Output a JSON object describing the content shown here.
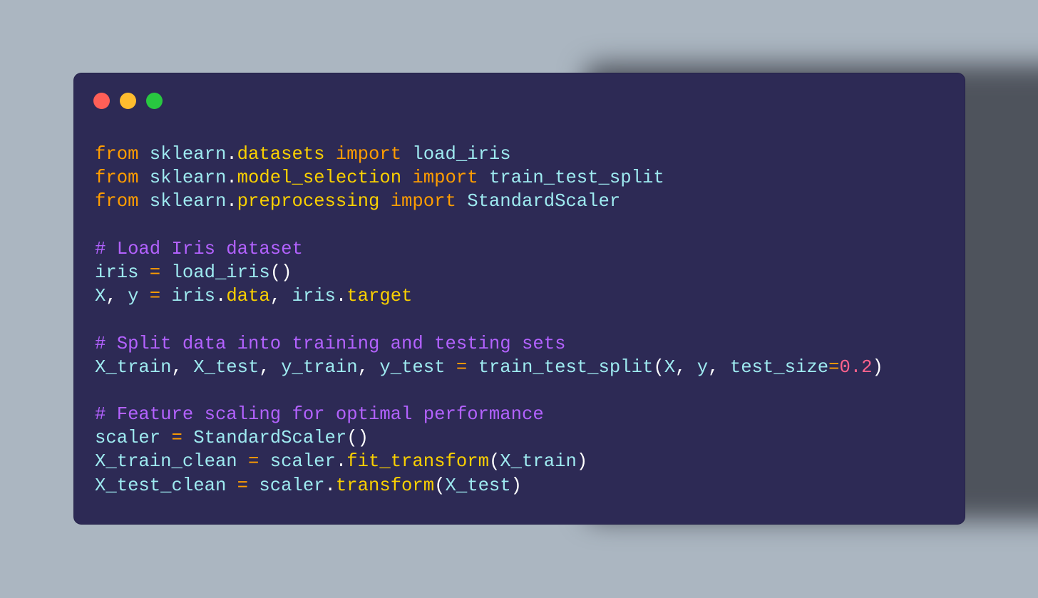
{
  "window": {
    "controls": [
      {
        "name": "close",
        "color": "#ff5f57"
      },
      {
        "name": "minimize",
        "color": "#febc2e"
      },
      {
        "name": "maximize",
        "color": "#28c840"
      }
    ]
  },
  "code": {
    "language": "python",
    "lines": [
      [
        [
          "keyword",
          "from"
        ],
        [
          "text",
          " "
        ],
        [
          "module",
          "sklearn"
        ],
        [
          "punct",
          "."
        ],
        [
          "attr",
          "datasets"
        ],
        [
          "text",
          " "
        ],
        [
          "keyword",
          "import"
        ],
        [
          "text",
          " "
        ],
        [
          "ident",
          "load_iris"
        ]
      ],
      [
        [
          "keyword",
          "from"
        ],
        [
          "text",
          " "
        ],
        [
          "module",
          "sklearn"
        ],
        [
          "punct",
          "."
        ],
        [
          "attr",
          "model_selection"
        ],
        [
          "text",
          " "
        ],
        [
          "keyword",
          "import"
        ],
        [
          "text",
          " "
        ],
        [
          "ident",
          "train_test_split"
        ]
      ],
      [
        [
          "keyword",
          "from"
        ],
        [
          "text",
          " "
        ],
        [
          "module",
          "sklearn"
        ],
        [
          "punct",
          "."
        ],
        [
          "attr",
          "preprocessing"
        ],
        [
          "text",
          " "
        ],
        [
          "keyword",
          "import"
        ],
        [
          "text",
          " "
        ],
        [
          "ident",
          "StandardScaler"
        ]
      ],
      [],
      [
        [
          "comment",
          "# Load Iris dataset"
        ]
      ],
      [
        [
          "ident",
          "iris"
        ],
        [
          "text",
          " "
        ],
        [
          "op",
          "="
        ],
        [
          "text",
          " "
        ],
        [
          "ident",
          "load_iris"
        ],
        [
          "punct",
          "()"
        ]
      ],
      [
        [
          "ident",
          "X"
        ],
        [
          "punct",
          ","
        ],
        [
          "text",
          " "
        ],
        [
          "ident",
          "y"
        ],
        [
          "text",
          " "
        ],
        [
          "op",
          "="
        ],
        [
          "text",
          " "
        ],
        [
          "ident",
          "iris"
        ],
        [
          "punct",
          "."
        ],
        [
          "attr",
          "data"
        ],
        [
          "punct",
          ","
        ],
        [
          "text",
          " "
        ],
        [
          "ident",
          "iris"
        ],
        [
          "punct",
          "."
        ],
        [
          "attr",
          "target"
        ]
      ],
      [],
      [
        [
          "comment",
          "# Split data into training and testing sets"
        ]
      ],
      [
        [
          "ident",
          "X_train"
        ],
        [
          "punct",
          ","
        ],
        [
          "text",
          " "
        ],
        [
          "ident",
          "X_test"
        ],
        [
          "punct",
          ","
        ],
        [
          "text",
          " "
        ],
        [
          "ident",
          "y_train"
        ],
        [
          "punct",
          ","
        ],
        [
          "text",
          " "
        ],
        [
          "ident",
          "y_test"
        ],
        [
          "text",
          " "
        ],
        [
          "op",
          "="
        ],
        [
          "text",
          " "
        ],
        [
          "ident",
          "train_test_split"
        ],
        [
          "punct",
          "("
        ],
        [
          "ident",
          "X"
        ],
        [
          "punct",
          ","
        ],
        [
          "text",
          " "
        ],
        [
          "ident",
          "y"
        ],
        [
          "punct",
          ","
        ],
        [
          "text",
          " "
        ],
        [
          "ident",
          "test_size"
        ],
        [
          "op",
          "="
        ],
        [
          "number",
          "0.2"
        ],
        [
          "punct",
          ")"
        ]
      ],
      [],
      [
        [
          "comment",
          "# Feature scaling for optimal performance"
        ]
      ],
      [
        [
          "ident",
          "scaler"
        ],
        [
          "text",
          " "
        ],
        [
          "op",
          "="
        ],
        [
          "text",
          " "
        ],
        [
          "ident",
          "StandardScaler"
        ],
        [
          "punct",
          "()"
        ]
      ],
      [
        [
          "ident",
          "X_train_clean"
        ],
        [
          "text",
          " "
        ],
        [
          "op",
          "="
        ],
        [
          "text",
          " "
        ],
        [
          "ident",
          "scaler"
        ],
        [
          "punct",
          "."
        ],
        [
          "attr",
          "fit_transform"
        ],
        [
          "punct",
          "("
        ],
        [
          "ident",
          "X_train"
        ],
        [
          "punct",
          ")"
        ]
      ],
      [
        [
          "ident",
          "X_test_clean"
        ],
        [
          "text",
          " "
        ],
        [
          "op",
          "="
        ],
        [
          "text",
          " "
        ],
        [
          "ident",
          "scaler"
        ],
        [
          "punct",
          "."
        ],
        [
          "attr",
          "transform"
        ],
        [
          "punct",
          "("
        ],
        [
          "ident",
          "X_test"
        ],
        [
          "punct",
          ")"
        ]
      ]
    ]
  },
  "colors": {
    "background": "#abb6c1",
    "window": "#2d2a55",
    "keyword": "#ff9d00",
    "identifier": "#9eeaf0",
    "attribute": "#fad000",
    "comment": "#b362ff",
    "number": "#ff628c",
    "punctuation": "#ffffff"
  }
}
